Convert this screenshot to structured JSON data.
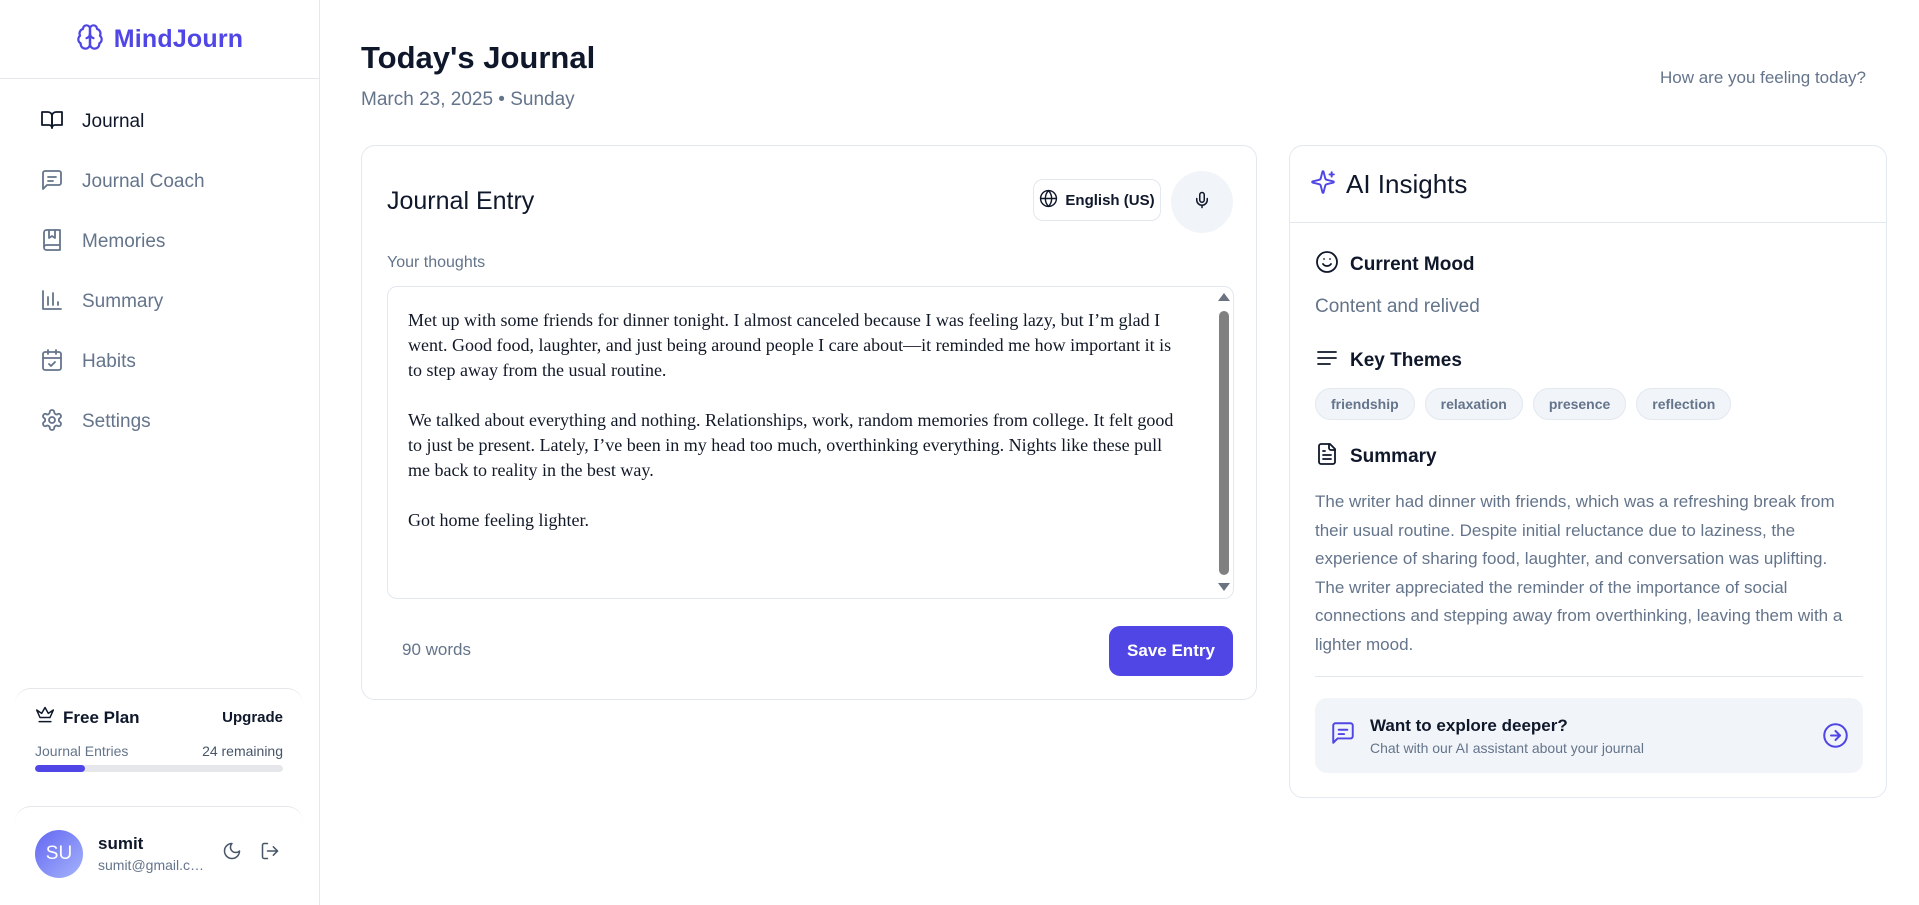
{
  "brand": {
    "name": "MindJourn"
  },
  "sidebar": {
    "items": [
      {
        "label": "Journal",
        "icon": "book-open-icon",
        "active": true
      },
      {
        "label": "Journal Coach",
        "icon": "message-square-icon",
        "active": false
      },
      {
        "label": "Memories",
        "icon": "bookmark-book-icon",
        "active": false
      },
      {
        "label": "Summary",
        "icon": "bar-chart-icon",
        "active": false
      },
      {
        "label": "Habits",
        "icon": "calendar-check-icon",
        "active": false
      },
      {
        "label": "Settings",
        "icon": "gear-icon",
        "active": false
      }
    ],
    "plan": {
      "title": "Free Plan",
      "upgrade_label": "Upgrade",
      "entries_label": "Journal Entries",
      "remaining_label": "24 remaining",
      "progress": 0.2
    },
    "user": {
      "initials": "SU",
      "name": "sumit",
      "email": "sumit@gmail.com"
    }
  },
  "header": {
    "title": "Today's Journal",
    "date": "March 23, 2025 • Sunday",
    "feeling_prompt": "How are you feeling today?"
  },
  "entry": {
    "title": "Journal Entry",
    "language": "English (US)",
    "thoughts_label": "Your thoughts",
    "paragraphs": [
      "Met up with some friends for dinner tonight. I almost canceled because I was feeling lazy, but I’m glad I went. Good food, laughter, and just being around people I care about—it reminded me how important it is to step away from the usual routine.",
      "We talked about everything and nothing. Relationships, work, random memories from college. It felt good to just be present. Lately, I’ve been in my head too much, overthinking everything. Nights like these pull me back to reality in the best way.",
      "Got home feeling lighter."
    ],
    "word_count": "90 words",
    "save_label": "Save Entry"
  },
  "insights": {
    "title": "AI Insights",
    "mood": {
      "heading": "Current Mood",
      "value": "Content and relived"
    },
    "themes": {
      "heading": "Key Themes",
      "tags": [
        "friendship",
        "relaxation",
        "presence",
        "reflection"
      ]
    },
    "summary": {
      "heading": "Summary",
      "text": "The writer had dinner with friends, which was a refreshing break from their usual routine. Despite initial reluctance due to laziness, the experience of sharing food, laughter, and conversation was uplifting. The writer appreciated the reminder of the importance of social connections and stepping away from overthinking, leaving them with a lighter mood."
    },
    "explore": {
      "title": "Want to explore deeper?",
      "subtitle": "Chat with our AI assistant about your journal"
    }
  },
  "colors": {
    "accent": "#4f46e5",
    "text": "#0f172a",
    "muted": "#64748b",
    "border": "#e2e8f0"
  }
}
